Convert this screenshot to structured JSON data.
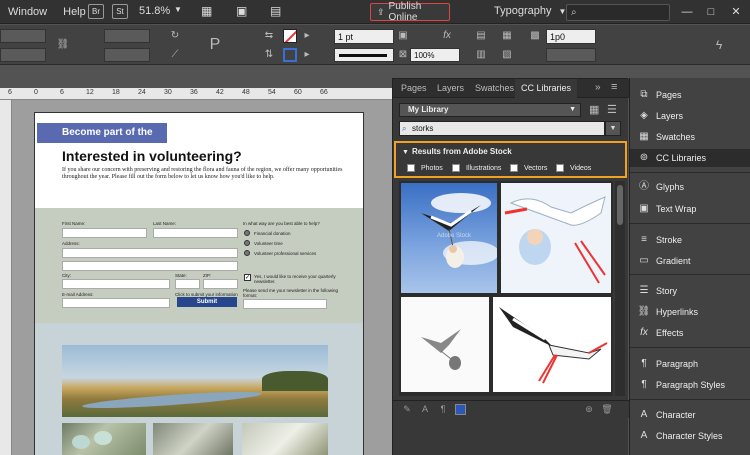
{
  "menubar": {
    "window": "Window",
    "help": "Help",
    "br": "Br",
    "st": "St",
    "zoom": "51.8%",
    "publish": "Publish Online",
    "workspace": "Typography"
  },
  "control": {
    "stroke_weight": "1 pt",
    "scale": "100%",
    "p0": "1p0"
  },
  "ruler": {
    "marks": [
      "6",
      "0",
      "6",
      "12",
      "18",
      "24",
      "30",
      "36",
      "42",
      "48",
      "54",
      "60",
      "66"
    ]
  },
  "document": {
    "banner": "Become part of the solution",
    "headline": "Interested in volunteering?",
    "intro": "If you share our concern with preserving and restoring the flora and fauna of the region, we offer many opportunities throughout the year. Please fill out the form below to let us know how you'd like to help.",
    "form": {
      "first_name": "First Name:",
      "last_name": "Last Name:",
      "address": "Address:",
      "city": "City:",
      "state": "State:",
      "zip": "ZIP:",
      "email": "E-mail Address:",
      "question": "In what way are you best able to help?",
      "opt1": "Financial donation",
      "opt2": "Volunteer time",
      "opt3": "Volunteer professional services",
      "newsletter": "Yes, I would like to receive your quarterly newsletter.",
      "format": "Please send me your newsletter in the following format:",
      "submit_hint": "Click to submit your information",
      "submit": "Submit"
    }
  },
  "panel": {
    "tabs": [
      "Pages",
      "Layers",
      "Swatches",
      "CC Libraries"
    ],
    "library": "My Library",
    "search_value": "storks",
    "results_title": "Results from Adobe Stock",
    "filters": [
      "Photos",
      "Illustrations",
      "Vectors",
      "Videos"
    ],
    "watermark": "Adobe Stock"
  },
  "dock": {
    "items": [
      "Pages",
      "Layers",
      "Swatches",
      "CC Libraries",
      "Glyphs",
      "Text Wrap",
      "Stroke",
      "Gradient",
      "Story",
      "Hyperlinks",
      "Effects",
      "Paragraph",
      "Paragraph Styles",
      "Character",
      "Character Styles"
    ]
  },
  "colors": {
    "accent_orange": "#f1a124",
    "banner_blue": "#5a6ab0",
    "submit_blue": "#27468c"
  }
}
